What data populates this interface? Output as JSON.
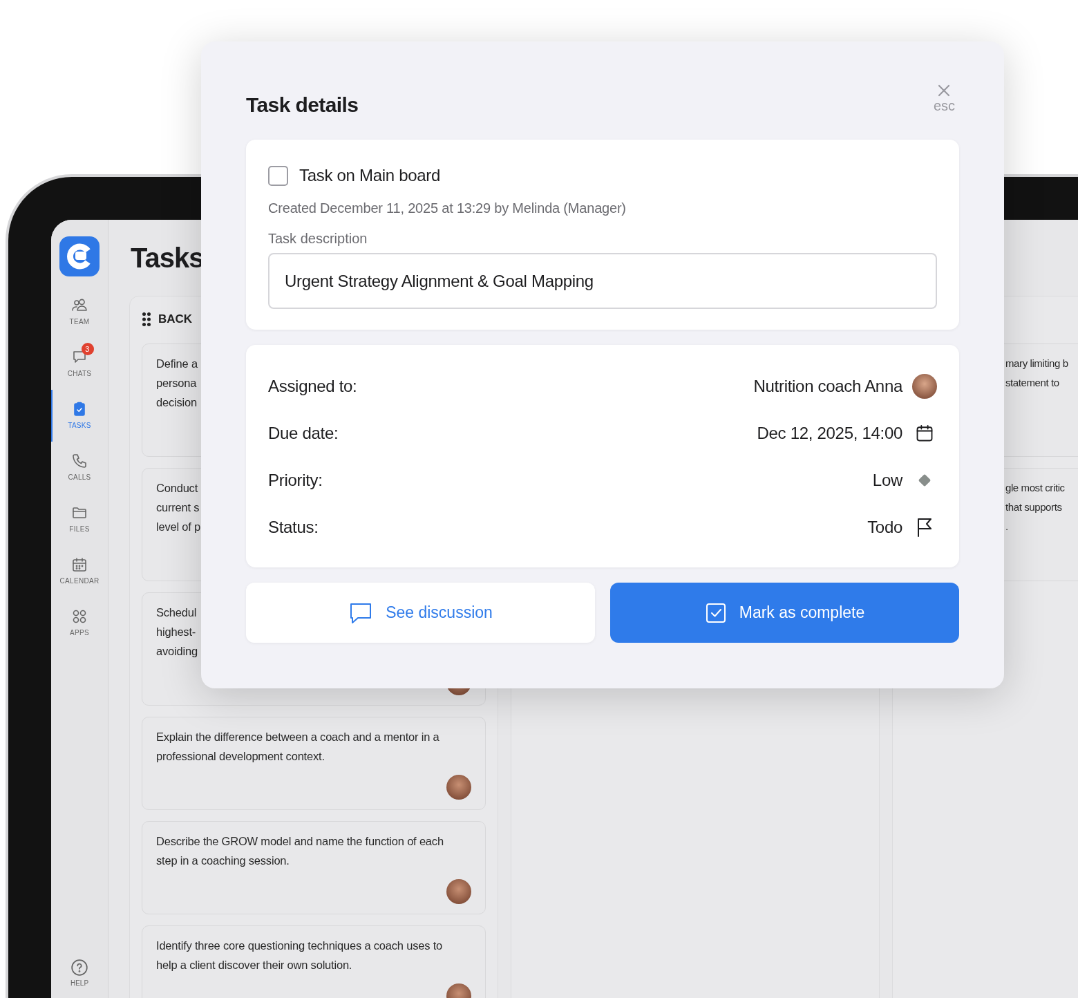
{
  "tablet": {
    "sidebar": {
      "items": [
        {
          "label": "TEAM",
          "selected": false
        },
        {
          "label": "CHATS",
          "selected": false,
          "badge": "3"
        },
        {
          "label": "TASKS",
          "selected": true
        },
        {
          "label": "CALLS",
          "selected": false
        },
        {
          "label": "FILES",
          "selected": false
        },
        {
          "label": "CALENDAR",
          "selected": false
        },
        {
          "label": "APPS",
          "selected": false
        }
      ],
      "help": "HELP"
    },
    "page_title": "Tasks",
    "columns": [
      {
        "title": "BACK",
        "cards": [
          {
            "lines": [
              "Define a",
              "persona",
              "decision"
            ]
          },
          {
            "lines": [
              "Conduct",
              "current s",
              "level of p"
            ]
          },
          {
            "lines": [
              "Schedul",
              "highest-",
              "avoiding"
            ],
            "avatar": true
          },
          {
            "lines": [
              "Explain the difference between a coach and a mentor in a",
              "professional development context."
            ],
            "avatar": true
          },
          {
            "lines": [
              "Describe the GROW model and name the function of each",
              "step in a coaching session."
            ],
            "avatar": true
          },
          {
            "lines": [
              "Identify three core questioning techniques a coach uses to",
              "help a client discover their own solution."
            ],
            "avatar": true
          }
        ]
      },
      {
        "cards": [
          {
            "lines": [
              "mary limiting b",
              "statement to"
            ]
          },
          {
            "lines": [
              "gle most critic",
              "that supports",
              "."
            ]
          }
        ]
      }
    ]
  },
  "modal": {
    "title": "Task details",
    "close_label": "esc",
    "task": {
      "checked": false,
      "title": "Task on Main board",
      "created": "Created December 11, 2025 at 13:29 by Melinda (Manager)",
      "description_label": "Task description",
      "description": "Urgent Strategy Alignment & Goal Mapping"
    },
    "fields": [
      {
        "label": "Assigned to:",
        "value": "Nutrition coach Anna",
        "kind": "avatar"
      },
      {
        "label": "Due date:",
        "value": "Dec 12, 2025, 14:00",
        "kind": "calendar"
      },
      {
        "label": "Priority:",
        "value": "Low",
        "kind": "priority"
      },
      {
        "label": "Status:",
        "value": "Todo",
        "kind": "flag"
      }
    ],
    "buttons": [
      {
        "label": "See discussion",
        "kind": "secondary"
      },
      {
        "label": "Mark as complete",
        "kind": "primary"
      }
    ]
  }
}
